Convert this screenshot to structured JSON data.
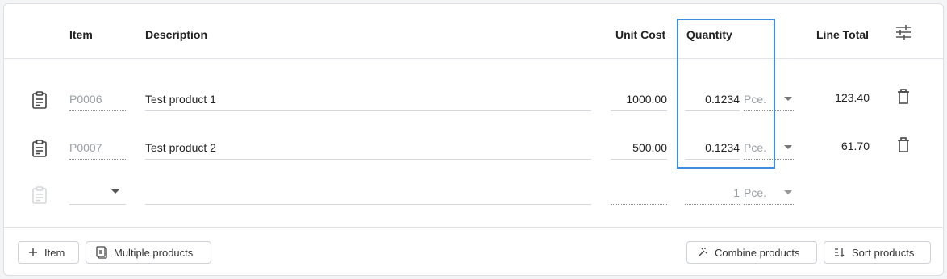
{
  "columns": {
    "item": "Item",
    "description": "Description",
    "unit_cost": "Unit Cost",
    "quantity": "Quantity",
    "line_total": "Line Total"
  },
  "rows": [
    {
      "item": "P0006",
      "description": "Test product 1",
      "unit_cost": "1000.00",
      "quantity": "0.1234",
      "unit": "Pce.",
      "line_total": "123.40"
    },
    {
      "item": "P0007",
      "description": "Test product 2",
      "unit_cost": "500.00",
      "quantity": "0.1234",
      "unit": "Pce.",
      "line_total": "61.70"
    }
  ],
  "new_row": {
    "quantity_placeholder": "1",
    "unit": "Pce."
  },
  "buttons": {
    "add_item": "Item",
    "multiple_products": "Multiple products",
    "combine_products": "Combine products",
    "sort_products": "Sort products"
  },
  "colors": {
    "highlight": "#3b8ee0",
    "border": "#dcdfe3"
  },
  "icons": [
    "clipboard-icon",
    "trash-icon",
    "settings-sliders-icon",
    "plus-icon",
    "magic-wand-icon",
    "sort-icon"
  ]
}
